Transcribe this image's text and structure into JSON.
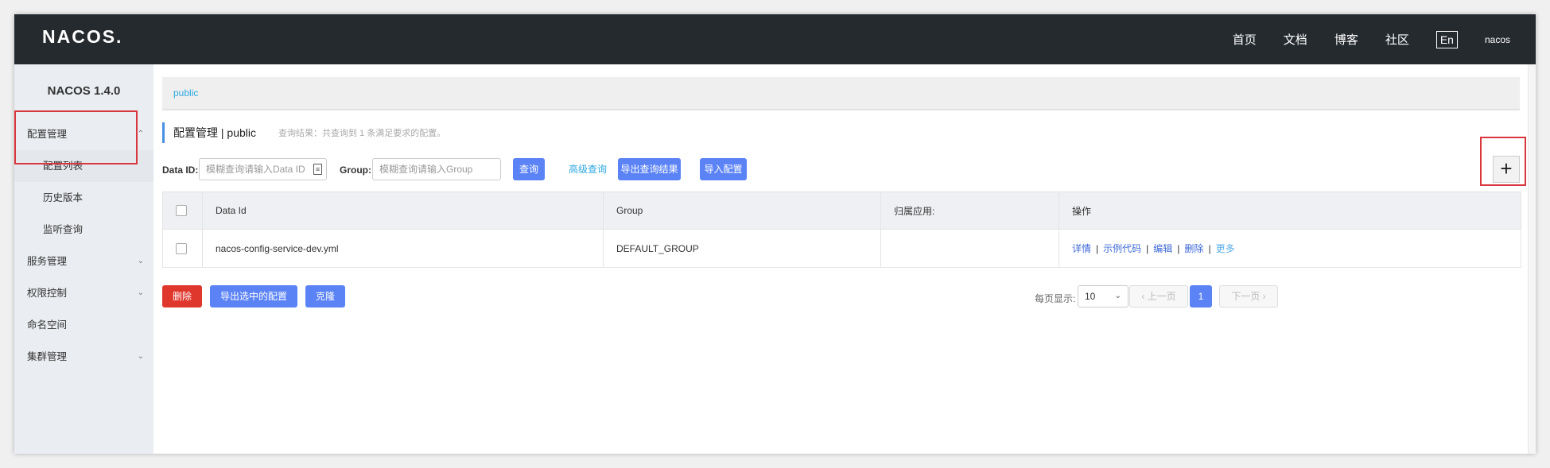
{
  "header": {
    "logo": "NACOS.",
    "nav": [
      "首页",
      "文档",
      "博客",
      "社区"
    ],
    "lang_button": "En",
    "user": "nacos"
  },
  "sidebar": {
    "version": "NACOS 1.4.0",
    "items": [
      {
        "label": "配置管理",
        "chevron": "up"
      },
      {
        "label": "配置列表"
      },
      {
        "label": "历史版本"
      },
      {
        "label": "监听查询"
      },
      {
        "label": "服务管理",
        "chevron": "down"
      },
      {
        "label": "权限控制",
        "chevron": "down"
      },
      {
        "label": "命名空间"
      },
      {
        "label": "集群管理",
        "chevron": "down"
      }
    ]
  },
  "breadcrumb": {
    "namespace": "public"
  },
  "title": {
    "main": "配置管理  |  public",
    "result": "查询结果：共查询到 1 条满足要求的配置。"
  },
  "filters": {
    "data_id_label": "Data ID:",
    "data_id_placeholder": "模糊查询请输入Data ID",
    "group_label": "Group:",
    "group_placeholder": "模糊查询请输入Group",
    "query_button": "查询",
    "advanced_query": "高级查询",
    "export_results_button": "导出查询结果",
    "import_button": "导入配置"
  },
  "add_button": "+",
  "table": {
    "columns": [
      "Data Id",
      "Group",
      "归属应用:",
      "操作"
    ],
    "rows": [
      {
        "data_id": "nacos-config-service-dev.yml",
        "group": "DEFAULT_GROUP",
        "app": ""
      }
    ],
    "ops": {
      "detail": "详情",
      "sample_code": "示例代码",
      "edit": "编辑",
      "delete": "删除",
      "more": "更多"
    }
  },
  "bottom": {
    "delete_button": "删除",
    "export_selected_button": "导出选中的配置",
    "clone_button": "克隆",
    "page_size_label": "每页显示:",
    "page_size": "10",
    "prev": "上一页",
    "current_page": "1",
    "next": "下一页"
  },
  "colors": {
    "topbar": "#252a2f",
    "primary": "#5b83f5",
    "danger": "#e0372d",
    "link": "#2fa8e0",
    "highlight": "#d9363e"
  }
}
